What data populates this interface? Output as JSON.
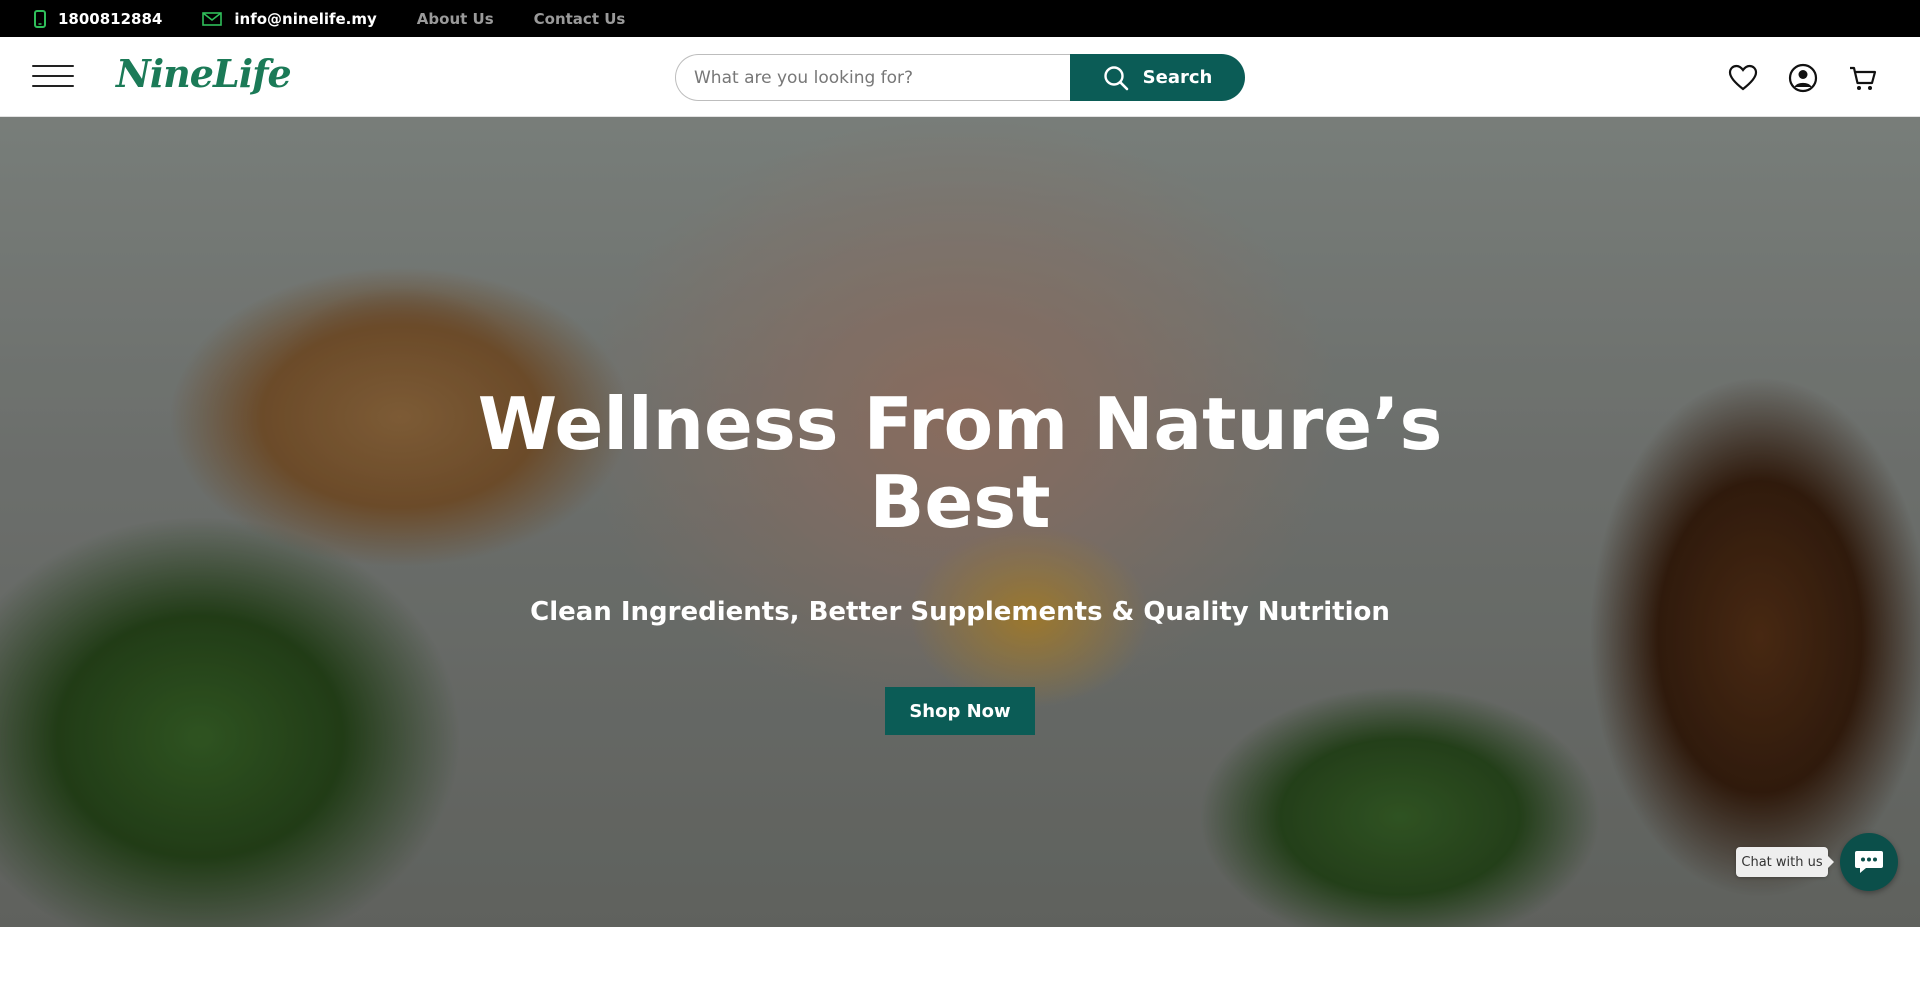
{
  "topbar": {
    "phone": "1800812884",
    "email": "info@ninelife.my",
    "links": [
      "About Us",
      "Contact Us"
    ],
    "icons": {
      "phone": "phone-icon",
      "email": "mail-icon"
    }
  },
  "header": {
    "logo": "NineLife",
    "search": {
      "placeholder": "What are you looking for?",
      "button_label": "Search"
    },
    "icons": [
      "menu-icon",
      "heart-icon",
      "account-icon",
      "cart-icon"
    ]
  },
  "hero": {
    "title": "Wellness From Nature’s Best",
    "subtitle": "Clean Ingredients, Better Supplements & Quality Nutrition",
    "cta_label": "Shop Now"
  },
  "chat": {
    "label": "Chat with us",
    "icon": "chat-icon"
  },
  "colors": {
    "brand": "#0b5c56",
    "logo": "#1b7a57",
    "topbar": "#000000",
    "phone_icon": "#2fbf5a"
  }
}
